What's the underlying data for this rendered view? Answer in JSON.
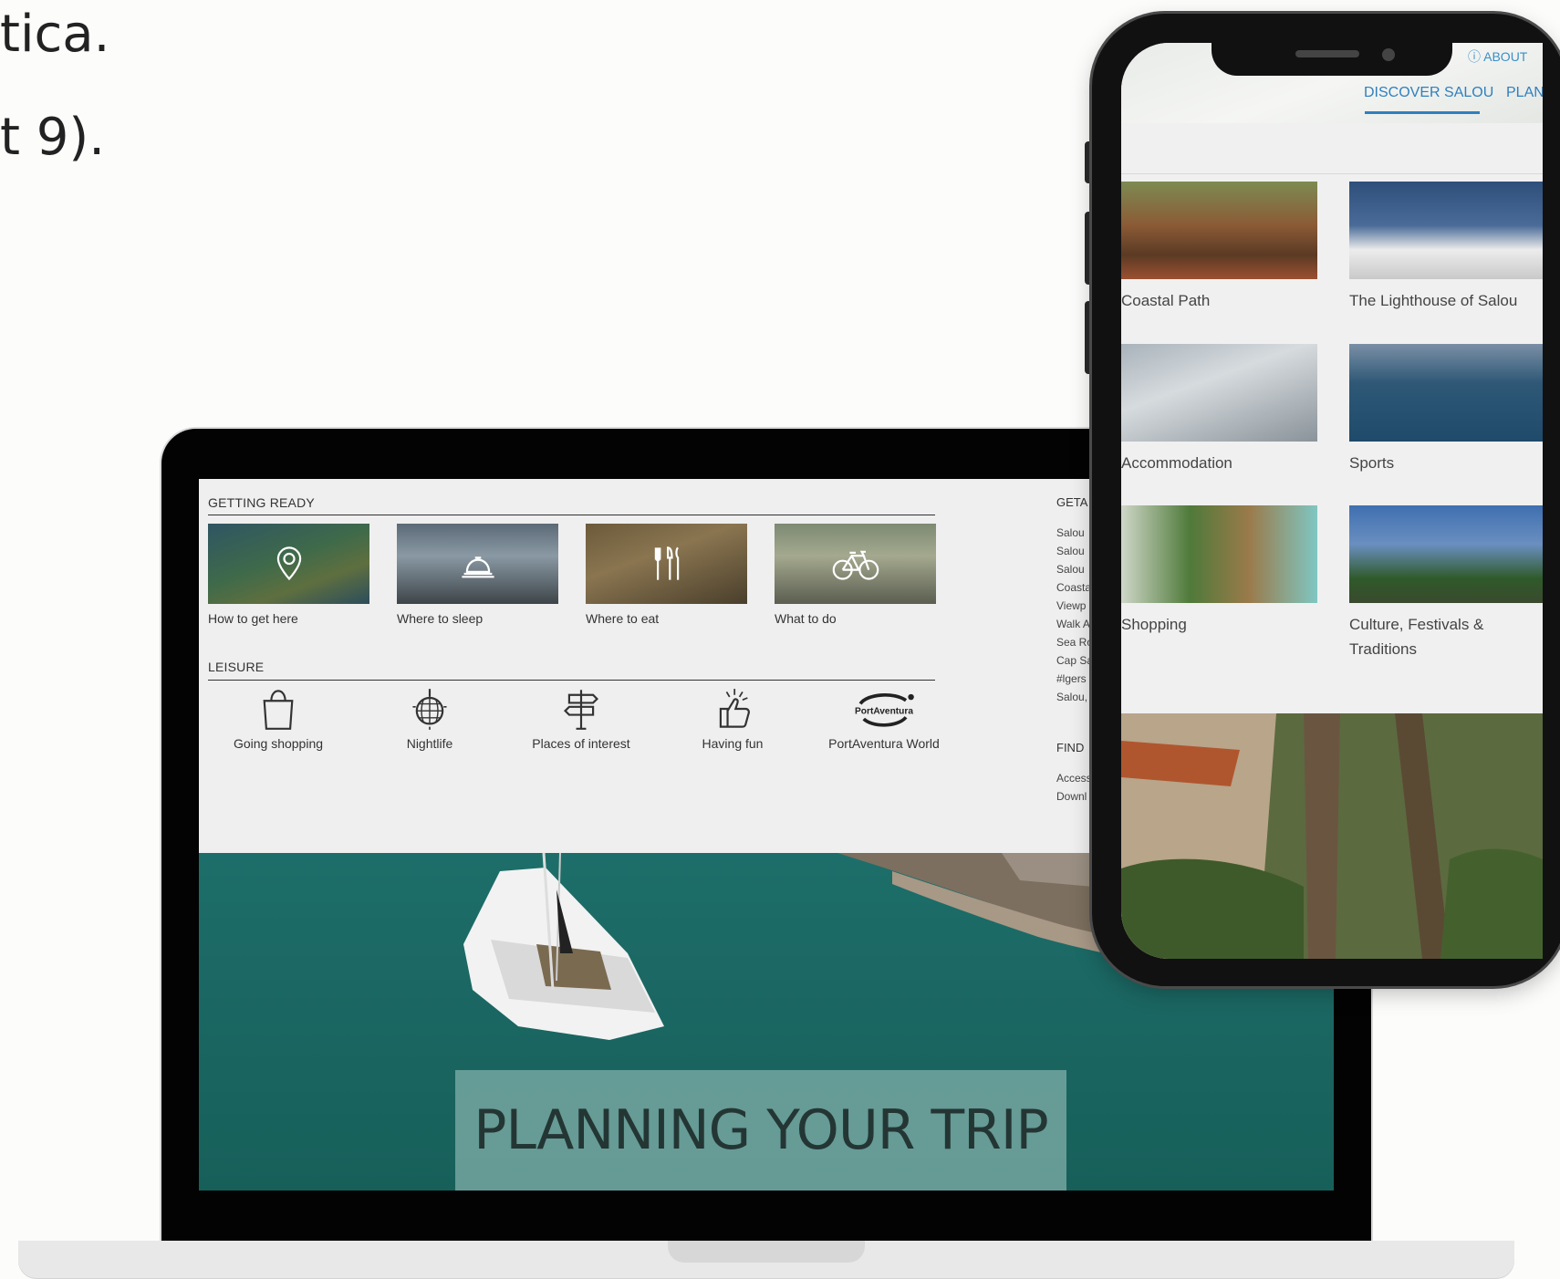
{
  "slide": {
    "line1": "tica.",
    "line2": "t 9)."
  },
  "laptop": {
    "getting_ready": {
      "title": "GETTING READY",
      "cards": [
        {
          "label": "How to get here",
          "icon": "location-pin-icon"
        },
        {
          "label": "Where to sleep",
          "icon": "hotel-bell-icon"
        },
        {
          "label": "Where to eat",
          "icon": "cutlery-icon"
        },
        {
          "label": "What to do",
          "icon": "bicycle-icon"
        }
      ]
    },
    "leisure": {
      "title": "LEISURE",
      "items": [
        {
          "label": "Going shopping",
          "icon": "shopping-bag-icon"
        },
        {
          "label": "Nightlife",
          "icon": "disco-ball-icon"
        },
        {
          "label": "Places of interest",
          "icon": "signpost-icon"
        },
        {
          "label": "Having fun",
          "icon": "thumbs-up-icon"
        },
        {
          "label": "PortAventura World",
          "icon": "portaventura-logo"
        }
      ],
      "logo_text": "PortAventura"
    },
    "side_column": {
      "heading1": "GETA",
      "items": [
        "Salou",
        "Salou",
        "Salou",
        "Coasta",
        "Viewp",
        "Walk A",
        "Sea Ro",
        "Cap Sa",
        "#lgers",
        "Salou,"
      ],
      "heading2": "FIND",
      "items2": [
        "Access",
        "Downl"
      ]
    },
    "hero_banner": "PLANNING YOUR TRIP"
  },
  "phone": {
    "about": "ABOUT",
    "tabs": [
      "DISCOVER SALOU",
      "PLAN"
    ],
    "cards": [
      {
        "label": "Coastal Path"
      },
      {
        "label": "The Lighthouse of Salou"
      },
      {
        "label": "Accommodation"
      },
      {
        "label": "Sports"
      },
      {
        "label": "Shopping"
      },
      {
        "label": "Culture, Festivals & Traditions"
      }
    ]
  },
  "colors": {
    "accent_blue": "#2f7fbf",
    "text_dark": "#333333",
    "sea": "#1b6763"
  }
}
